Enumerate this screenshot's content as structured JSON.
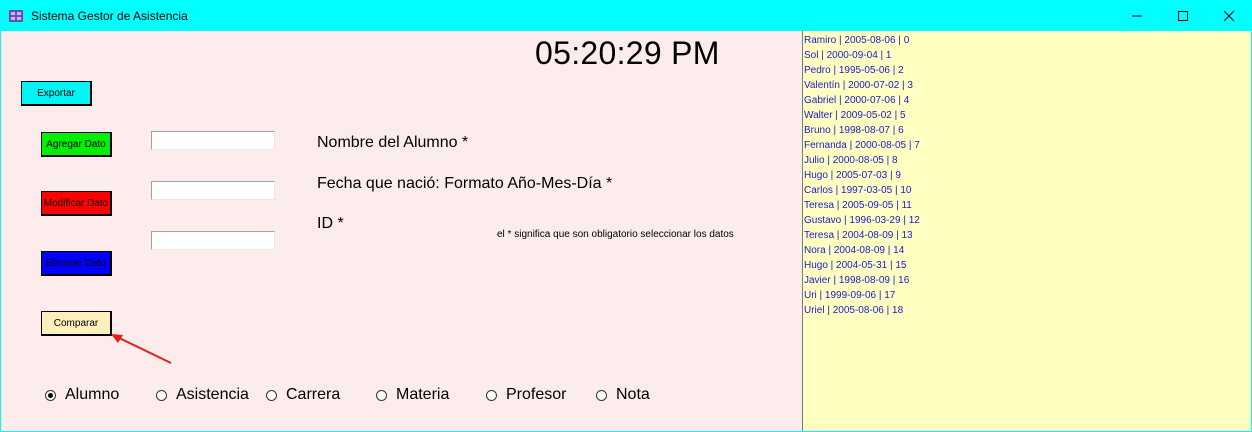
{
  "window": {
    "title": "Sistema Gestor de Asistencia"
  },
  "clock": "05:20:29 PM",
  "buttons": {
    "exportar": "Exportar",
    "agregar": "Agregar Dato",
    "modificar": "Modificar Dato",
    "eliminar": "Eliminar Dato",
    "comparar": "Comparar"
  },
  "colors": {
    "exportar": "#00f5f5",
    "agregar": "#00f000",
    "modificar": "#ff0000",
    "eliminar": "#0000ff",
    "comparar": "#ffefbd",
    "list_bg": "#ffffc1",
    "client_bg": "#fdecec"
  },
  "fields": [
    {
      "value": ""
    },
    {
      "value": ""
    },
    {
      "value": ""
    }
  ],
  "labels": {
    "nombre": "Nombre del Alumno *",
    "fecha": "Fecha que nació: Formato Año-Mes-Día *",
    "id": "ID *",
    "note": "el * significa que son obligatorio seleccionar los datos"
  },
  "radios": [
    {
      "label": "Alumno",
      "checked": true
    },
    {
      "label": "Asistencia",
      "checked": false
    },
    {
      "label": "Carrera",
      "checked": false
    },
    {
      "label": "Materia",
      "checked": false
    },
    {
      "label": "Profesor",
      "checked": false
    },
    {
      "label": "Nota",
      "checked": false
    }
  ],
  "list_items": [
    "Ramiro | 2005-08-06 | 0",
    "Sol | 2000-09-04 | 1",
    "Pedro | 1995-05-06 | 2",
    "Valentín | 2000-07-02 | 3",
    "Gabriel | 2000-07-06 | 4",
    "Walter | 2009-05-02 | 5",
    "Bruno | 1998-08-07 | 6",
    "Fernanda | 2000-08-05 | 7",
    "Julio | 2000-08-05 | 8",
    "Hugo | 2005-07-03 | 9",
    "Carlos | 1997-03-05 | 10",
    "Teresa | 2005-09-05 | 11",
    "Gustavo | 1996-03-29 | 12",
    "Teresa | 2004-08-09 | 13",
    "Nora | 2004-08-09 | 14",
    "Hugo | 2004-05-31 | 15",
    "Javier | 1998-08-09 | 16",
    "Uri | 1999-09-06 | 17",
    "Uriel | 2005-08-06 | 18"
  ],
  "icons": {
    "app": "app-icon",
    "minimize": "minimize-icon",
    "maximize": "maximize-icon",
    "close": "close-icon",
    "annotation": "arrow-icon"
  }
}
